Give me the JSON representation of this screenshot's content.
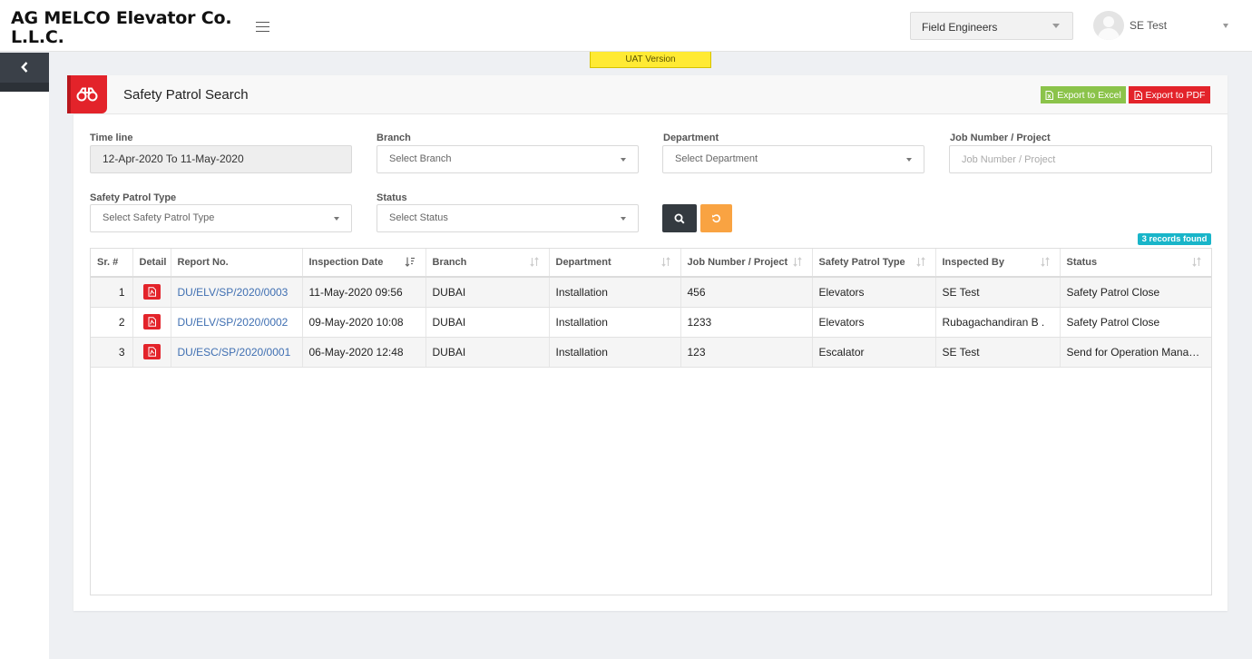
{
  "header": {
    "brand": "AG MELCO Elevator Co. L.L.C.",
    "role_select": "Field Engineers",
    "user_name": "SE Test",
    "uat_label": "UAT Version"
  },
  "card": {
    "title": "Safety Patrol Search",
    "export_excel": "Export to Excel",
    "export_pdf": "Export to PDF"
  },
  "filters": {
    "timeline": {
      "label": "Time line",
      "value": "12-Apr-2020 To 11-May-2020"
    },
    "branch": {
      "label": "Branch",
      "value": "Select Branch"
    },
    "department": {
      "label": "Department",
      "value": "Select Department"
    },
    "job": {
      "label": "Job Number / Project",
      "placeholder": "Job Number / Project"
    },
    "patrol_type": {
      "label": "Safety Patrol Type",
      "value": "Select Safety Patrol Type"
    },
    "status": {
      "label": "Status",
      "value": "Select Status"
    }
  },
  "records_found": "3 records found",
  "table": {
    "columns": [
      "Sr. #",
      "Detail",
      "Report No.",
      "Inspection Date",
      "Branch",
      "Department",
      "Job Number / Project",
      "Safety Patrol Type",
      "Inspected By",
      "Status"
    ],
    "rows": [
      {
        "sr": "1",
        "report": "DU/ELV/SP/2020/0003",
        "date": "11-May-2020 09:56",
        "branch": "DUBAI",
        "department": "Installation",
        "job": "456",
        "type": "Elevators",
        "inspected_by": "SE Test",
        "status": "Safety Patrol Close"
      },
      {
        "sr": "2",
        "report": "DU/ELV/SP/2020/0002",
        "date": "09-May-2020 10:08",
        "branch": "DUBAI",
        "department": "Installation",
        "job": "1233",
        "type": "Elevators",
        "inspected_by": "Rubagachandiran B .",
        "status": "Safety Patrol Close"
      },
      {
        "sr": "3",
        "report": "DU/ESC/SP/2020/0001",
        "date": "06-May-2020 12:48",
        "branch": "DUBAI",
        "department": "Installation",
        "job": "123",
        "type": "Escalator",
        "inspected_by": "SE Test",
        "status": "Send for Operation Manager Approval"
      }
    ]
  },
  "colors": {
    "accent": "#e3232a",
    "excel": "#8bc34a",
    "reset": "#f9a342",
    "search": "#343a40",
    "badge": "#19b5c9",
    "link": "#3f6fb2",
    "uat": "#ffea34"
  },
  "icons": [
    "menu-icon",
    "chevron-left-icon",
    "binoculars-icon",
    "file-excel-icon",
    "file-pdf-icon",
    "search-icon",
    "reset-icon",
    "sort-icon",
    "sort-desc-icon",
    "user-avatar-icon"
  ]
}
